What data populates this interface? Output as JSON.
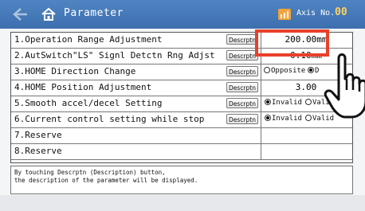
{
  "header": {
    "title": "Parameter",
    "axis_label": "Axis No.",
    "axis_number": "00"
  },
  "rows": [
    {
      "index": "1.",
      "label": "Operation Range Adjustment",
      "desc": "Descrptn",
      "value": "200.00mm"
    },
    {
      "index": "2.",
      "label": "AutSwitch\"LS\" Signl Detctn Rng Adjst",
      "desc": "Descrptn",
      "value": "0.10mm"
    },
    {
      "index": "3.",
      "label": "HOME Direction Change",
      "desc": "Descrptn",
      "opt1": "Opposite",
      "opt2": "D"
    },
    {
      "index": "4.",
      "label": "HOME Position Adjustment",
      "desc": "Descrptn",
      "value": "3.00"
    },
    {
      "index": "5.",
      "label": "Smooth accel/decel Setting",
      "desc": "Descrptn",
      "opt1": "Invalid",
      "opt2": "Valid"
    },
    {
      "index": "6.",
      "label": "Current control setting while stop",
      "desc": "Descrptn",
      "opt1": "Invalid",
      "opt2": "Valid"
    },
    {
      "index": "7.",
      "label": "Reserve"
    },
    {
      "index": "8.",
      "label": "Reserve"
    }
  ],
  "info": {
    "line1": "By touching Descrptn (Description) button,",
    "line2": "the description of the parameter will be displayed."
  },
  "colors": {
    "header": "#3d6fae",
    "highlight": "#e8402a",
    "axis_number": "#ffd35a"
  }
}
